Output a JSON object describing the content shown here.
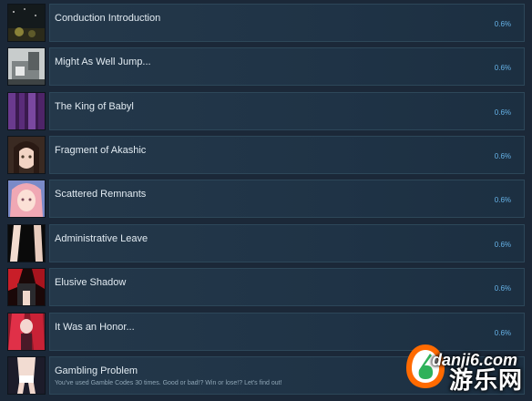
{
  "achievements": [
    {
      "title": "Conduction Introduction",
      "desc": "",
      "pct": "0.6%",
      "icon": "night-scene-icon"
    },
    {
      "title": "Might As Well Jump...",
      "desc": "",
      "pct": "0.6%",
      "icon": "robot-machine-icon"
    },
    {
      "title": "The King of Babyl",
      "desc": "",
      "pct": "0.6%",
      "icon": "purple-hair-portrait-icon"
    },
    {
      "title": "Fragment of Akashic",
      "desc": "",
      "pct": "0.6%",
      "icon": "dark-hair-girl-portrait-icon"
    },
    {
      "title": "Scattered Remnants",
      "desc": "",
      "pct": "0.6%",
      "icon": "pink-hair-girl-portrait-icon"
    },
    {
      "title": "Administrative Leave",
      "desc": "",
      "pct": "0.6%",
      "icon": "silhouette-figure-icon"
    },
    {
      "title": "Elusive Shadow",
      "desc": "",
      "pct": "0.6%",
      "icon": "red-dark-figure-icon"
    },
    {
      "title": "It Was an Honor...",
      "desc": "",
      "pct": "0.6%",
      "icon": "red-hair-character-icon"
    },
    {
      "title": "Gambling Problem",
      "desc": "You've used Gamble Codes 30 times. Good or bad!? Win or lose!? Let's find out!",
      "pct": "",
      "icon": "character-figure-icon"
    }
  ],
  "watermark": {
    "url": "danji6.com",
    "text": "游乐网"
  },
  "colors": {
    "background": "#1b2838",
    "card": "#22374a",
    "percent": "#66b3e8",
    "logo_orange": "#ff6a00",
    "logo_green": "#2fb15a"
  }
}
